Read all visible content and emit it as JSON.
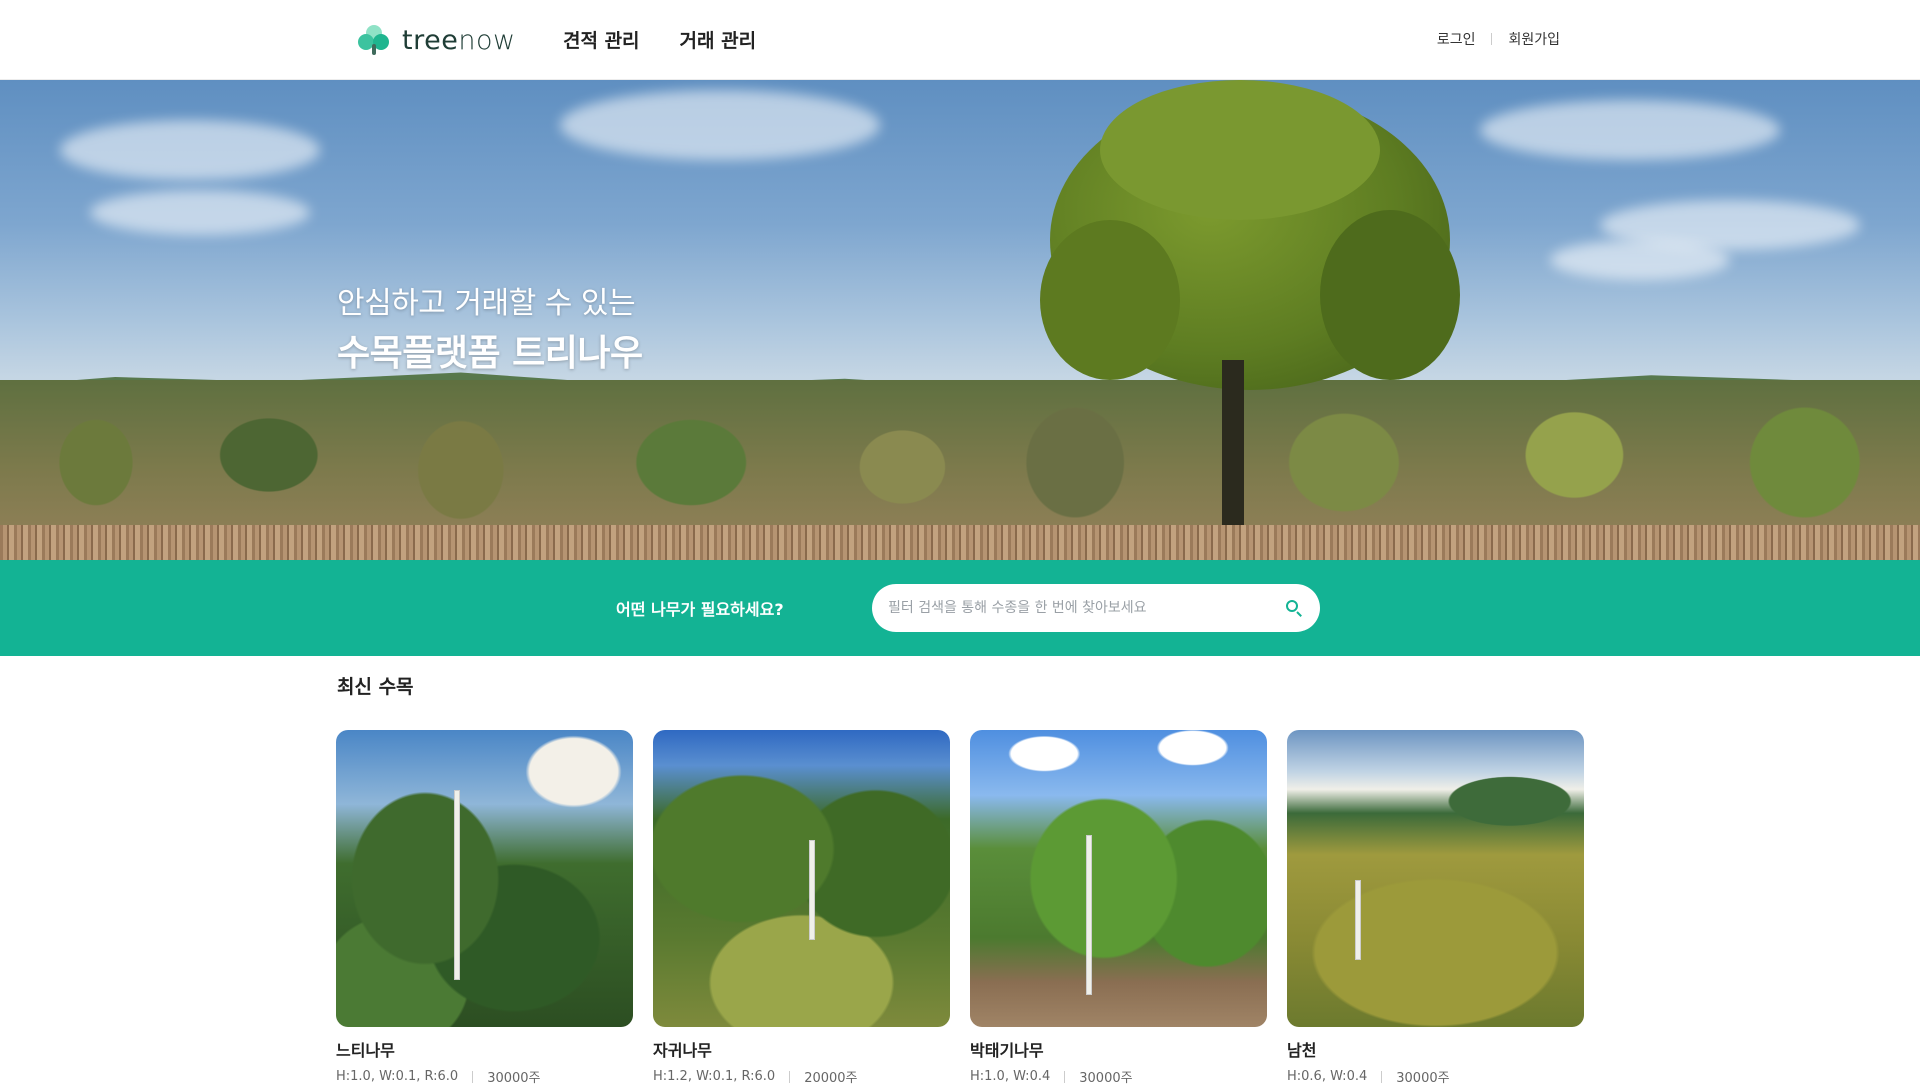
{
  "header": {
    "logo": {
      "part1": "tree",
      "part2": "now"
    },
    "nav": [
      {
        "label": "견적 관리"
      },
      {
        "label": "거래 관리"
      }
    ],
    "auth": {
      "login": "로그인",
      "signup": "회원가입"
    }
  },
  "hero": {
    "line1": "안심하고 거래할 수 있는",
    "line2": "수목플랫폼 트리나우"
  },
  "search": {
    "prompt": "어떤 나무가 필요하세요?",
    "placeholder": "필터 검색을 통해 수종을 한 번에 찾아보세요",
    "value": ""
  },
  "latest": {
    "title": "최신 수목",
    "items": [
      {
        "name": "느티나무",
        "spec": "H:1.0,  W:0.1,  R:6.0",
        "qty": "30000주"
      },
      {
        "name": "자귀나무",
        "spec": "H:1.2,  W:0.1,  R:6.0",
        "qty": "20000주"
      },
      {
        "name": "박태기나무",
        "spec": "H:1.0,  W:0.4",
        "qty": "30000주"
      },
      {
        "name": "남천",
        "spec": "H:0.6,  W:0.4",
        "qty": "30000주"
      }
    ]
  },
  "colors": {
    "accent": "#13b394",
    "text": "#222222",
    "muted": "#666666"
  }
}
